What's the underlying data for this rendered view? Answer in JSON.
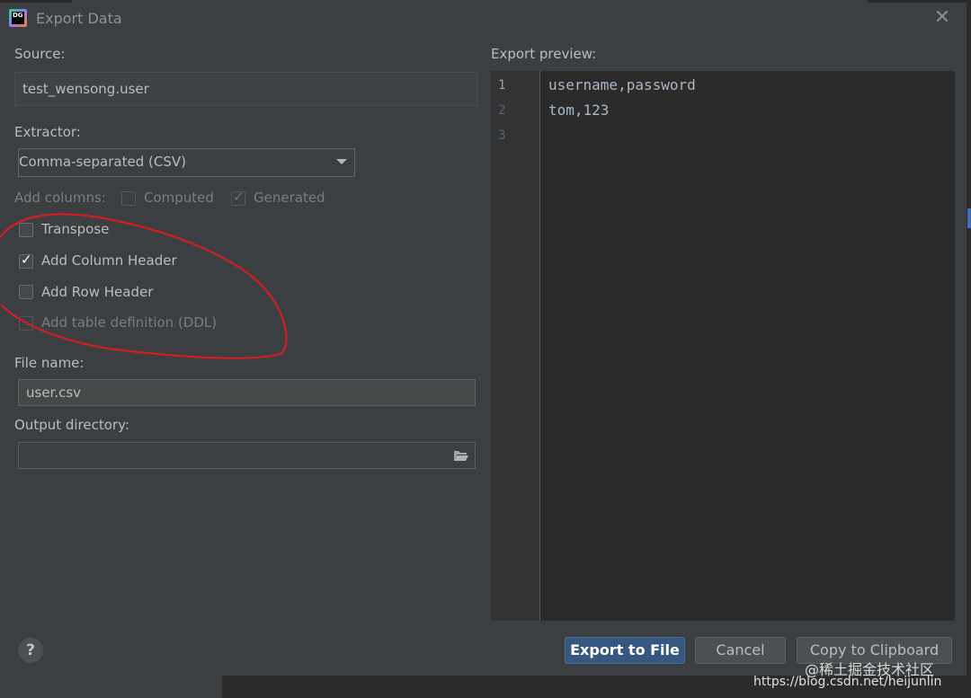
{
  "window": {
    "title": "Export Data",
    "app_icon_text": "DG"
  },
  "source": {
    "label": "Source:",
    "value": "test_wensong.user"
  },
  "extractor": {
    "label": "Extractor:",
    "selected": "Comma-separated (CSV)"
  },
  "add_columns": {
    "label": "Add columns:",
    "computed": {
      "label": "Computed",
      "checked": false,
      "enabled": false
    },
    "generated": {
      "label": "Generated",
      "checked": true,
      "enabled": false
    }
  },
  "options": [
    {
      "label": "Transpose",
      "checked": false,
      "enabled": true
    },
    {
      "label": "Add Column Header",
      "checked": true,
      "enabled": true
    },
    {
      "label": "Add Row Header",
      "checked": false,
      "enabled": true
    },
    {
      "label": "Add table definition (DDL)",
      "checked": false,
      "enabled": false
    }
  ],
  "file_name": {
    "label": "File name:",
    "value": "user.csv"
  },
  "output_directory": {
    "label": "Output directory:",
    "value": ""
  },
  "preview": {
    "label": "Export preview:",
    "line_numbers": [
      "1",
      "2",
      "3"
    ],
    "lines": [
      "username,password",
      "tom,123",
      ""
    ]
  },
  "buttons": {
    "help": "?",
    "export": "Export to File",
    "cancel": "Cancel",
    "copy": "Copy to Clipboard"
  },
  "watermark": {
    "line1": "@稀土掘金技术社区",
    "line2": "https://blog.csdn.net/heijunlin"
  },
  "annotation_color": "#d11f1f",
  "colors": {
    "primary_button": "#365880",
    "dialog_bg": "#3c3f41",
    "editor_bg": "#2b2b2b"
  }
}
